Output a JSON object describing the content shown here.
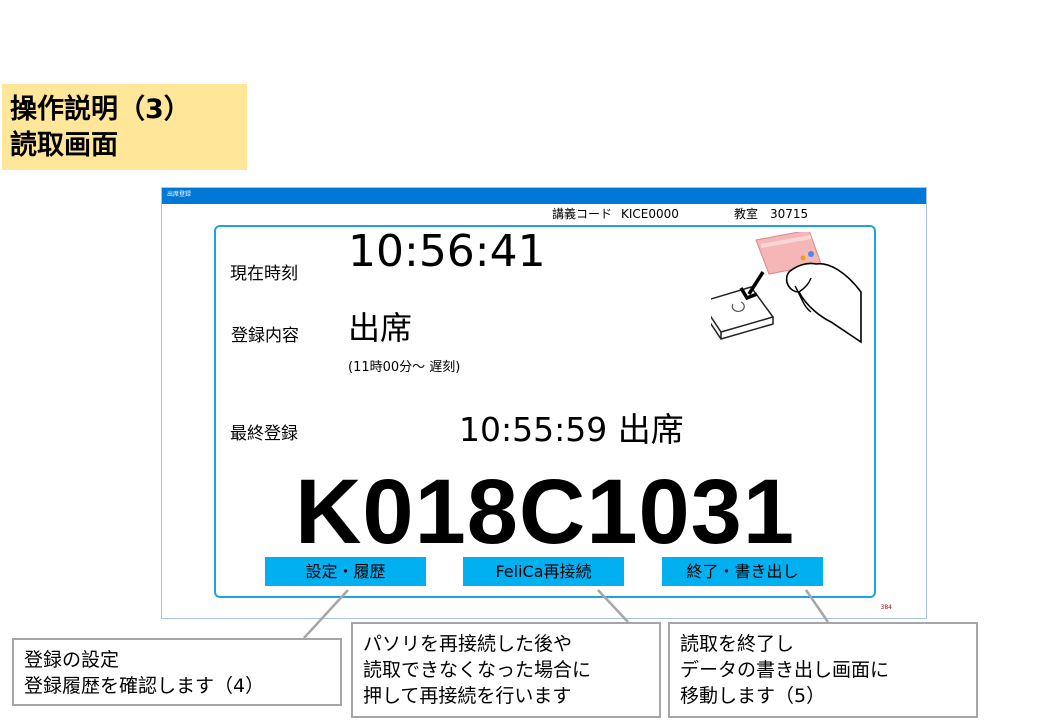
{
  "slide": {
    "title_line1": "操作説明（3）",
    "title_line2": "読取画面",
    "page_number": "384"
  },
  "window": {
    "title": "出席登録",
    "course_code_label": "講義コード",
    "course_code": "KICE0000",
    "room_label": "教室",
    "room": "30715"
  },
  "main": {
    "current_time_label": "現在時刻",
    "current_time": "10:56:41",
    "registration_label": "登録内容",
    "registration_status": "出席",
    "registration_note": "(11時00分～ 遅刻)",
    "last_registration_label": "最終登録",
    "last_registration_value": "10:55:59 出席",
    "student_id": "K018C1031"
  },
  "buttons": {
    "settings_history": "設定・履歴",
    "felica_reconnect": "FeliCa再接続",
    "finish_export": "終了・書き出し"
  },
  "colors": {
    "title_bg": "#ffe699",
    "titlebar": "#0078d7",
    "accent": "#00b0f0",
    "frame": "#1fa3e0"
  },
  "callouts": {
    "settings": [
      "登録の設定",
      "登録履歴を確認します（4）"
    ],
    "reconnect": [
      "パソリを再接続した後や",
      "読取できなくなった場合に",
      "押して再接続を行います"
    ],
    "finish": [
      "読取を終了し",
      "データの書き出し画面に",
      "移動します（5）"
    ]
  },
  "icons": [
    "card-reader-icon",
    "down-arrow-icon",
    "hand-holding-card-icon"
  ]
}
